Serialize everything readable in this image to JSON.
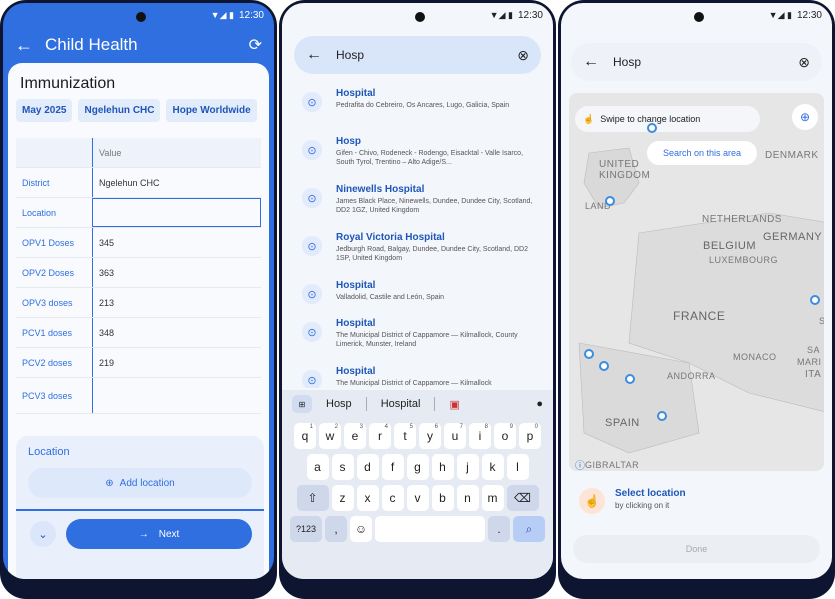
{
  "status": {
    "time": "12:30"
  },
  "screen1": {
    "app_title": "Child Health",
    "section_title": "Immunization",
    "chips": [
      "May 2025",
      "Ngelehun CHC",
      "Hope Worldwide"
    ],
    "column_header": "Value",
    "rows": [
      {
        "label": "District",
        "value": "Ngelehun CHC"
      },
      {
        "label": "Location",
        "value": ""
      },
      {
        "label": "OPV1 Doses",
        "value": "345"
      },
      {
        "label": "OPV2 Doses",
        "value": "363"
      },
      {
        "label": "OPV3 doses",
        "value": "213"
      },
      {
        "label": "PCV1 doses",
        "value": "348"
      },
      {
        "label": "PCV2 doses",
        "value": "219"
      },
      {
        "label": "PCV3 doses",
        "value": ""
      }
    ],
    "location_title": "Location",
    "add_location": "Add location",
    "next": "Next"
  },
  "screen2": {
    "query": "Hosp",
    "results": [
      {
        "title": "Hospital",
        "subtitle": "Pedrafita do Cebreiro, Os Ancares, Lugo, Galicia, Spain"
      },
      {
        "title": "Hosp",
        "subtitle": "Gifen - Chivo, Rodeneck - Rodengo, Eisacktal - Valle Isarco, South Tyrol, Trentino – Alto Adige/S..."
      },
      {
        "title": "Ninewells Hospital",
        "subtitle": "James Black Place, Ninewells, Dundee, Dundee City, Scotland, DD2 1GZ, United Kingdom"
      },
      {
        "title": "Royal Victoria Hospital",
        "subtitle": "Jedburgh Road, Balgay, Dundee, Dundee City, Scotland, DD2 1SP, United Kingdom"
      },
      {
        "title": "Hospital",
        "subtitle": "Valladolid, Castile and León, Spain"
      },
      {
        "title": "Hospital",
        "subtitle": "The Municipal District of Cappamore — Kilmallock, County Limerick, Munster, Ireland"
      },
      {
        "title": "Hospital",
        "subtitle": "The Municipal District of Cappamore — Kilmallock"
      }
    ],
    "suggestions": [
      "Hosp",
      "Hospital"
    ],
    "keys_row1": [
      "q",
      "w",
      "e",
      "r",
      "t",
      "y",
      "u",
      "i",
      "o",
      "p"
    ],
    "keys_row1_nums": [
      "1",
      "2",
      "3",
      "4",
      "5",
      "6",
      "7",
      "8",
      "9",
      "0"
    ],
    "keys_row2": [
      "a",
      "s",
      "d",
      "f",
      "g",
      "h",
      "j",
      "k",
      "l"
    ],
    "keys_row3": [
      "z",
      "x",
      "c",
      "v",
      "b",
      "n",
      "m"
    ],
    "key_num": "?123",
    "key_comma": ",",
    "key_period": "."
  },
  "screen3": {
    "query": "Hosp",
    "swipe_hint": "Swipe to change location",
    "search_area": "Search on this area",
    "map_labels": [
      "UNITED KINGDOM",
      "DENMARK",
      "NETHERLANDS",
      "BELGIUM",
      "GERMANY",
      "LUXEMBOURG",
      "FRANCE",
      "MONACO",
      "ANDORRA",
      "SPAIN",
      "GIBRALTAR",
      "ITA",
      "MARI",
      "SA",
      "S",
      "LAND"
    ],
    "select_title": "Select location",
    "select_sub": "by clicking on it",
    "done": "Done"
  }
}
